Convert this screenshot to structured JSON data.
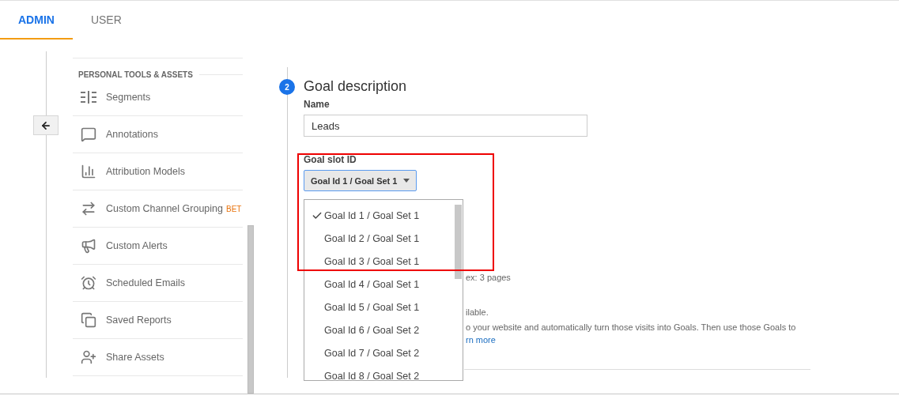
{
  "tabs": [
    {
      "label": "ADMIN",
      "selected": true
    },
    {
      "label": "USER",
      "selected": false
    }
  ],
  "sidebar": {
    "section_title": "PERSONAL TOOLS & ASSETS",
    "items": [
      {
        "label": "Segments"
      },
      {
        "label": "Annotations"
      },
      {
        "label": "Attribution Models"
      },
      {
        "label": "Custom Channel Grouping",
        "badge": "BET"
      },
      {
        "label": "Custom Alerts"
      },
      {
        "label": "Scheduled Emails"
      },
      {
        "label": "Saved Reports"
      },
      {
        "label": "Share Assets"
      }
    ]
  },
  "goal": {
    "step": "2",
    "title": "Goal description",
    "name_label": "Name",
    "name_value": "Leads",
    "slot_label": "Goal slot ID",
    "slot_value": "Goal Id 1 / Goal Set 1",
    "options": [
      {
        "label": "Goal Id 1 / Goal Set 1",
        "selected": true
      },
      {
        "label": "Goal Id 2 / Goal Set 1",
        "selected": false
      },
      {
        "label": "Goal Id 3 / Goal Set 1",
        "selected": false
      },
      {
        "label": "Goal Id 4 / Goal Set 1",
        "selected": false
      },
      {
        "label": "Goal Id 5 / Goal Set 1",
        "selected": false
      },
      {
        "label": "Goal Id 6 / Goal Set 2",
        "selected": false
      },
      {
        "label": "Goal Id 7 / Goal Set 2",
        "selected": false
      },
      {
        "label": "Goal Id 8 / Goal Set 2",
        "selected": false
      }
    ],
    "hint": "ex: 3 pages",
    "note": "ilable.",
    "description": "o your website and automatically turn those visits into Goals. Then use those Goals to",
    "link": "rn more"
  }
}
